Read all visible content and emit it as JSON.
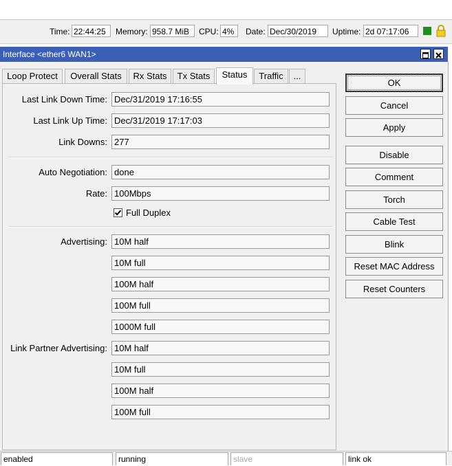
{
  "topbar": {
    "time_label": "Time:",
    "time_value": "22:44:25",
    "memory_label": "Memory:",
    "memory_value": "958.7 MiB",
    "cpu_label": "CPU:",
    "cpu_value": "4%",
    "date_label": "Date:",
    "date_value": "Dec/30/2019",
    "uptime_label": "Uptime:",
    "uptime_value": "2d 07:17:06"
  },
  "window": {
    "title": "Interface <ether6 WAN1>"
  },
  "tabs": [
    "Loop Protect",
    "Overall Stats",
    "Rx Stats",
    "Tx Stats",
    "Status",
    "Traffic",
    "..."
  ],
  "active_tab": "Status",
  "status": {
    "last_link_down_label": "Last Link Down Time:",
    "last_link_down_value": "Dec/31/2019 17:16:55",
    "last_link_up_label": "Last Link Up Time:",
    "last_link_up_value": "Dec/31/2019 17:17:03",
    "link_downs_label": "Link Downs:",
    "link_downs_value": "277",
    "auto_neg_label": "Auto Negotiation:",
    "auto_neg_value": "done",
    "rate_label": "Rate:",
    "rate_value": "100Mbps",
    "full_duplex_label": "Full Duplex",
    "full_duplex_checked": true,
    "advertising_label": "Advertising:",
    "advertising": [
      "10M half",
      "10M full",
      "100M half",
      "100M full",
      "1000M full"
    ],
    "partner_label": "Link Partner Advertising:",
    "partner_advertising": [
      "10M half",
      "10M full",
      "100M half",
      "100M full"
    ]
  },
  "buttons": [
    "OK",
    "Cancel",
    "Apply",
    "Disable",
    "Comment",
    "Torch",
    "Cable Test",
    "Blink",
    "Reset MAC Address",
    "Reset Counters"
  ],
  "statusbar": [
    "enabled",
    "running",
    "slave",
    "link ok"
  ]
}
